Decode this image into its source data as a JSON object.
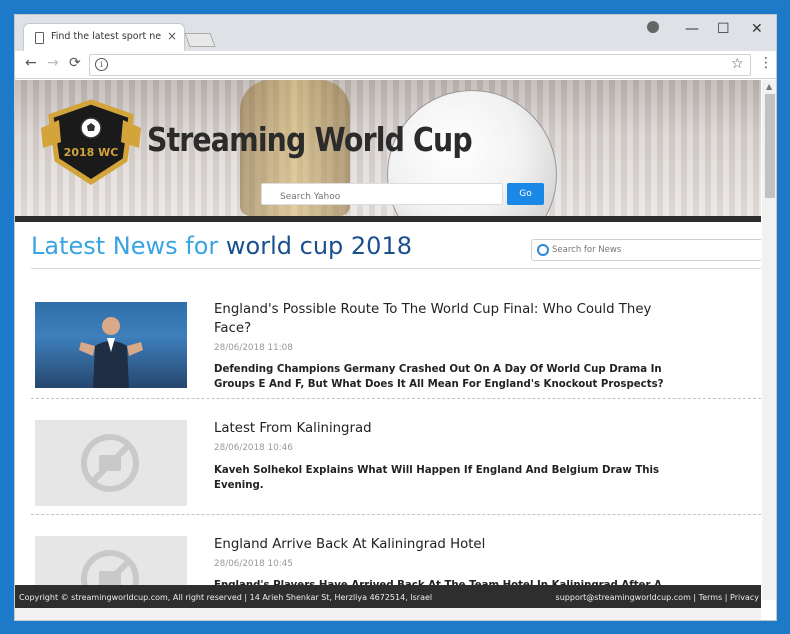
{
  "browser": {
    "tab_title": "Find the latest sport news",
    "close_glyph": "×",
    "window_controls": {
      "minimize": "—",
      "maximize": "☐",
      "close": "✕"
    },
    "nav": {
      "back": "←",
      "forward": "→",
      "reload": "⟳"
    },
    "info_glyph": "i",
    "star_glyph": "☆",
    "menu_glyph": "⋮"
  },
  "site": {
    "logo_text": "Streaming World Cup",
    "logo_badge_text": "2018 WC",
    "hero_search_placeholder": "Search Yahoo",
    "hero_go_label": "Go",
    "heading_part1": "Latest News for",
    "heading_part2": "world cup 2018",
    "news_search_placeholder": "Search for News"
  },
  "articles": [
    {
      "title": "England's Possible Route To The World Cup Final: Who Could They Face?",
      "date": "28/06/2018 11:08",
      "summary": "Defending Champions Germany Crashed Out On A Day Of World Cup Drama In Groups E And F, But What Does It All Mean For England's Knockout Prospects?",
      "has_photo": true
    },
    {
      "title": "Latest From Kaliningrad",
      "date": "28/06/2018 10:46",
      "summary": "Kaveh Solhekol Explains What Will Happen If England And Belgium Draw This Evening.",
      "has_photo": false
    },
    {
      "title": "England Arrive Back At Kaliningrad Hotel",
      "date": "28/06/2018 10:45",
      "summary": "England's Players Have Arrived Back At The Team Hotel In Kaliningrad After A Light Training Session Ahead Of The Game Against Belgium This Evening.",
      "has_photo": false
    }
  ],
  "footer": {
    "left": "Copyright © streamingworldcup.com, All right reserved | 14 Arieh Shenkar St, Herzliya 4672514, Israel",
    "email": "support@streamingworldcup.com",
    "sep": "|",
    "terms": "Terms",
    "privacy": "Privacy"
  },
  "colors": {
    "heading_light": "#3aa4e3",
    "heading_dark": "#1a4f8e",
    "go_button": "#1a88e6",
    "footer_bg": "#2e2e2e"
  }
}
